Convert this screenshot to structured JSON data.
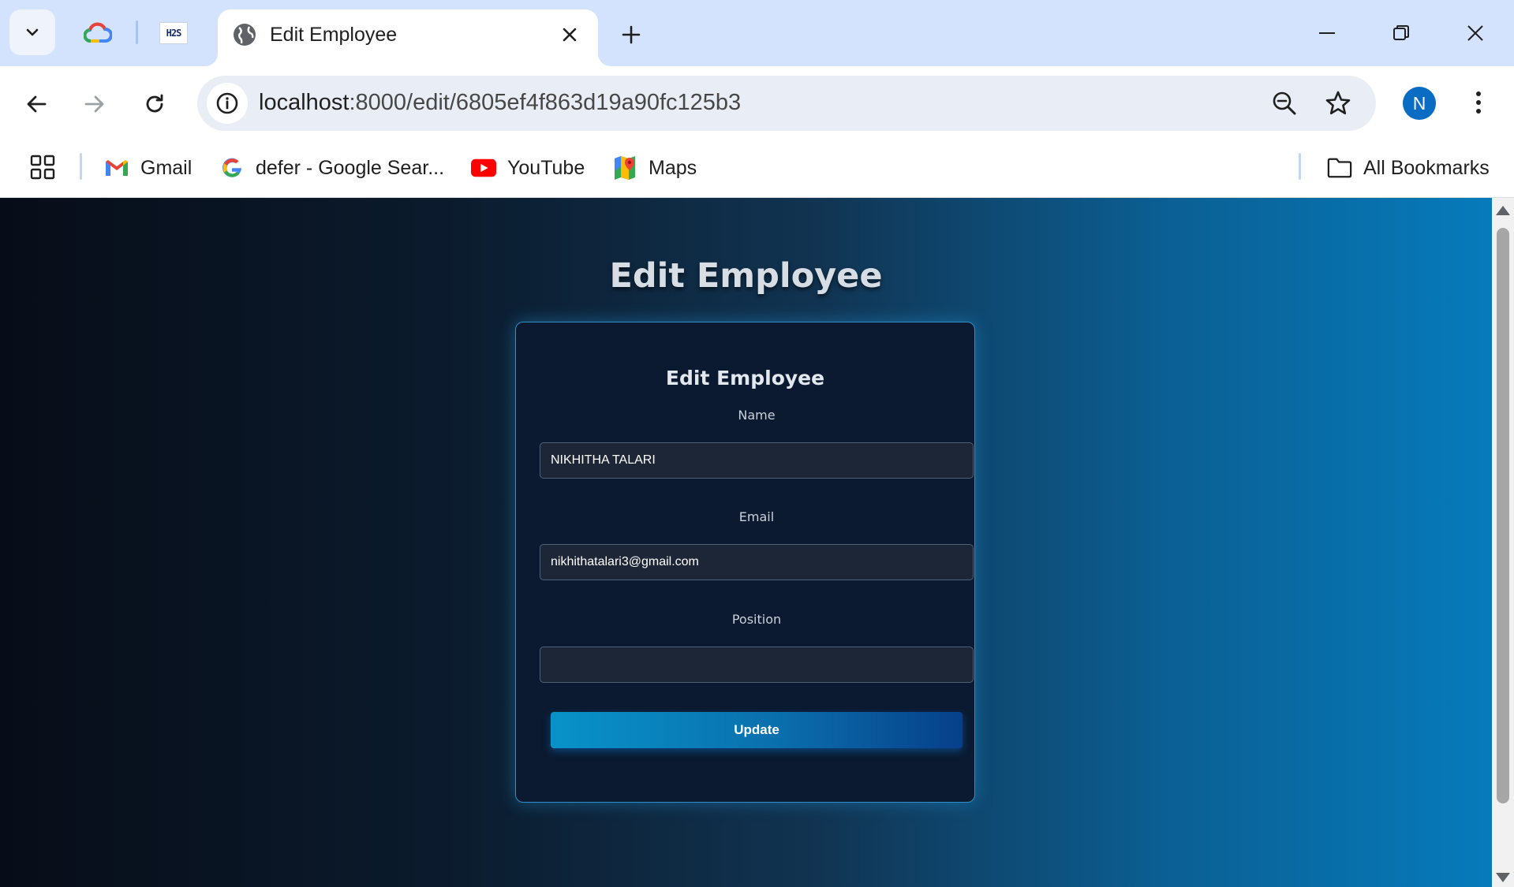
{
  "browser": {
    "tabs": [
      {
        "label": "Google Cloud",
        "icon": "google-cloud-icon"
      },
      {
        "label": "H2S",
        "icon": "h2s-icon"
      }
    ],
    "active_tab": {
      "title": "Edit Employee",
      "icon": "globe-icon"
    },
    "url": {
      "host": "localhost",
      "path": ":8000/edit/6805ef4f863d19a90fc125b3"
    },
    "profile_initial": "N",
    "bookmarks": [
      {
        "label": "Gmail",
        "icon": "gmail-icon"
      },
      {
        "label": "defer - Google Sear...",
        "icon": "google-icon"
      },
      {
        "label": "YouTube",
        "icon": "youtube-icon"
      },
      {
        "label": "Maps",
        "icon": "maps-icon"
      }
    ],
    "all_bookmarks_label": "All Bookmarks"
  },
  "page": {
    "heading": "Edit Employee",
    "form": {
      "title": "Edit Employee",
      "name_label": "Name",
      "name_value": "NIKHITHA TALARI",
      "email_label": "Email",
      "email_value": "nikhithatalari3@gmail.com",
      "position_label": "Position",
      "position_value": "",
      "submit_label": "Update"
    }
  },
  "colors": {
    "tabstrip_bg": "#d3e3fd",
    "accent_blue": "#0b6cc4",
    "card_border": "#2f90c8",
    "button_gradient_start": "#0893c9",
    "button_gradient_end": "#073f8a"
  }
}
